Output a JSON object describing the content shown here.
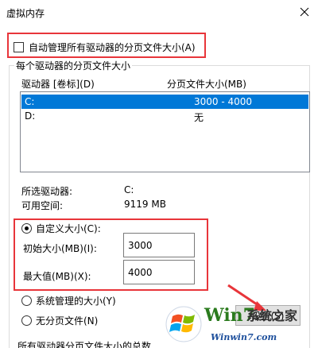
{
  "window": {
    "title": "虚拟内存"
  },
  "auto_manage": {
    "label": "自动管理所有驱动器的分页文件大小(A)",
    "checked": false
  },
  "group": {
    "legend": "每个驱动器的分页文件大小"
  },
  "drive_list": {
    "columns": [
      "驱动器 [卷标](D)",
      "分页文件大小(MB)"
    ],
    "rows": [
      {
        "drive": "C:",
        "size": "3000 - 4000",
        "selected": true
      },
      {
        "drive": "D:",
        "size": "无",
        "selected": false
      }
    ]
  },
  "selected_drive": {
    "label": "所选驱动器:",
    "value": "C:"
  },
  "free_space": {
    "label": "可用空间:",
    "value": "9119 MB"
  },
  "options": {
    "custom": {
      "label": "自定义大小(C):",
      "checked": true
    },
    "initial": {
      "label": "初始大小(MB)(I):",
      "value": "3000"
    },
    "max": {
      "label": "最大值(MB)(X):",
      "value": "4000"
    },
    "system": {
      "label": "系统管理的大小(Y)",
      "checked": false
    },
    "none": {
      "label": "无分页文件(N)",
      "checked": false
    }
  },
  "set_button": {
    "label": "设置(S)"
  },
  "bottom_text": "所有驱动器分页文件大小的总数",
  "watermark": {
    "brand": "Win7",
    "site": "系统之家",
    "url": "Winwin7.com"
  },
  "colors": {
    "highlight": "#e8353a",
    "selection": "#0078d7"
  }
}
